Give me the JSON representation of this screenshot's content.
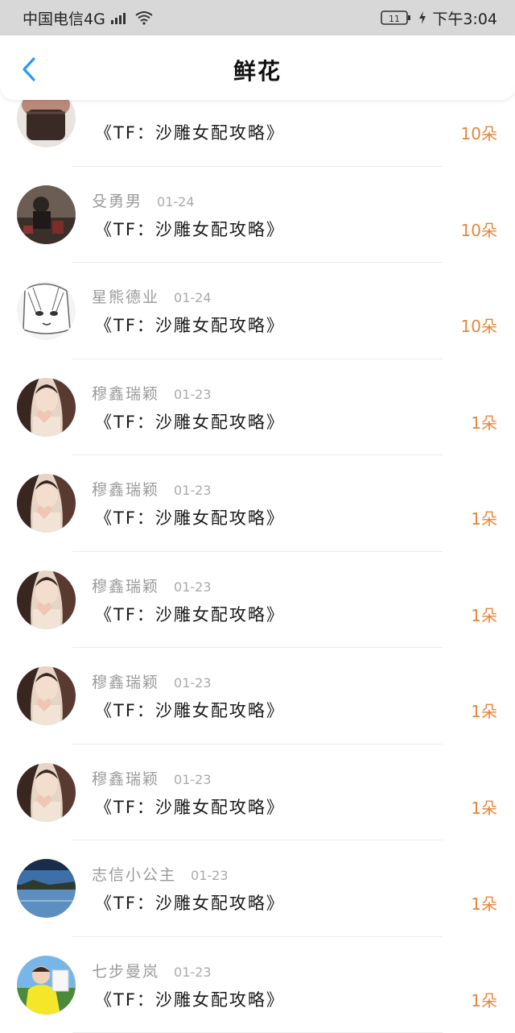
{
  "status_bar": {
    "carrier": "中国电信4G",
    "network": "4G",
    "battery": "11",
    "time": "下午3:04"
  },
  "header": {
    "title": "鲜花"
  },
  "colors": {
    "accent": "#2a9af0",
    "count": "#e8853a",
    "status_bar_bg": "#d8d8d8"
  },
  "rows": [
    {
      "username": "",
      "date": "",
      "book": "《TF：沙雕女配攻略》",
      "count": "10朵",
      "avatar": "cupcake-avatar"
    },
    {
      "username": "殳勇男",
      "date": "01-24",
      "book": "《TF：沙雕女配攻略》",
      "count": "10朵",
      "avatar": "person-dark-avatar"
    },
    {
      "username": "星熊德业",
      "date": "01-24",
      "book": "《TF：沙雕女配攻略》",
      "count": "10朵",
      "avatar": "anime-sketch-avatar"
    },
    {
      "username": "穆鑫瑞颖",
      "date": "01-23",
      "book": "《TF：沙雕女配攻略》",
      "count": "1朵",
      "avatar": "girl-heart-avatar"
    },
    {
      "username": "穆鑫瑞颖",
      "date": "01-23",
      "book": "《TF：沙雕女配攻略》",
      "count": "1朵",
      "avatar": "girl-heart-avatar"
    },
    {
      "username": "穆鑫瑞颖",
      "date": "01-23",
      "book": "《TF：沙雕女配攻略》",
      "count": "1朵",
      "avatar": "girl-heart-avatar"
    },
    {
      "username": "穆鑫瑞颖",
      "date": "01-23",
      "book": "《TF：沙雕女配攻略》",
      "count": "1朵",
      "avatar": "girl-heart-avatar"
    },
    {
      "username": "穆鑫瑞颖",
      "date": "01-23",
      "book": "《TF：沙雕女配攻略》",
      "count": "1朵",
      "avatar": "girl-heart-avatar"
    },
    {
      "username": "志信小公主",
      "date": "01-23",
      "book": "《TF：沙雕女配攻略》",
      "count": "1朵",
      "avatar": "lake-landscape-avatar"
    },
    {
      "username": "七步曼岚",
      "date": "01-23",
      "book": "《TF：沙雕女配攻略》",
      "count": "1朵",
      "avatar": "child-photo-avatar"
    }
  ]
}
